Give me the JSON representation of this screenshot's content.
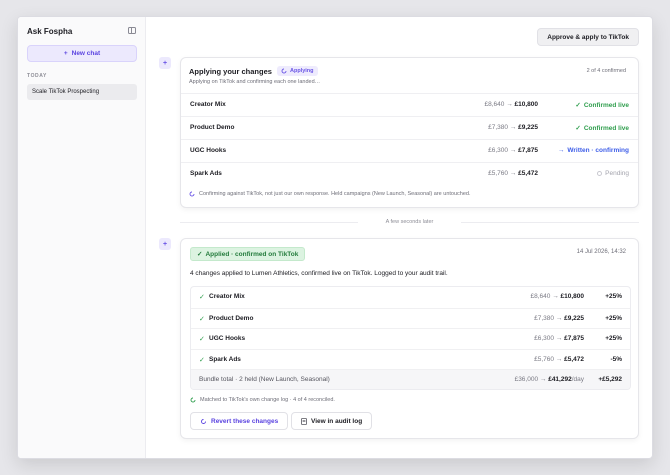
{
  "sidebar": {
    "title": "Ask Fospha",
    "new_chat_label": "New chat",
    "section_label": "TODAY",
    "chats": [
      "Scale TikTok Prospecting"
    ]
  },
  "header": {
    "approve_label": "Approve & apply to TikTok"
  },
  "apply_card": {
    "title": "Applying your changes",
    "status_pill": "Applying",
    "subtitle": "Applying on TikTok and confirming each one landed…",
    "progress": "2 of 4 confirmed",
    "rows": [
      {
        "name": "Creator Mix",
        "from": "£8,640",
        "to": "£10,800",
        "status": "Confirmed live"
      },
      {
        "name": "Product Demo",
        "from": "£7,380",
        "to": "£9,225",
        "status": "Confirmed live"
      },
      {
        "name": "UGC Hooks",
        "from": "£6,300",
        "to": "£7,875",
        "status": "Written · confirming"
      },
      {
        "name": "Spark Ads",
        "from": "£5,760",
        "to": "£5,472",
        "status": "Pending"
      }
    ],
    "note": "Confirming against TikTok, not just our own response. Held campaigns (New Launch, Seasonal) are untouched."
  },
  "separator": "A few seconds later",
  "result_card": {
    "badge": "Applied · confirmed on TikTok",
    "date": "14 Jul 2026, 14:32",
    "description": "4 changes applied to Lumen Athletics, confirmed live on TikTok. Logged to your audit trail.",
    "rows": [
      {
        "name": "Creator Mix",
        "from": "£8,640",
        "to": "£10,800",
        "delta": "+25%"
      },
      {
        "name": "Product Demo",
        "from": "£7,380",
        "to": "£9,225",
        "delta": "+25%"
      },
      {
        "name": "UGC Hooks",
        "from": "£6,300",
        "to": "£7,875",
        "delta": "+25%"
      },
      {
        "name": "Spark Ads",
        "from": "£5,760",
        "to": "£5,472",
        "delta": "-5%"
      }
    ],
    "total": {
      "label": "Bundle total · 2 held (New Launch, Seasonal)",
      "from": "£36,000",
      "to": "£41,292",
      "per": "/day",
      "delta": "+£5,292"
    },
    "match_note": "Matched to TikTok's own change log · 4 of 4 reconciled.",
    "revert_label": "Revert these changes",
    "audit_label": "View in audit log"
  },
  "arrow": "→",
  "colors": {
    "accent": "#5a43e0",
    "success": "#2f9e4d",
    "info": "#3e5ee8"
  }
}
